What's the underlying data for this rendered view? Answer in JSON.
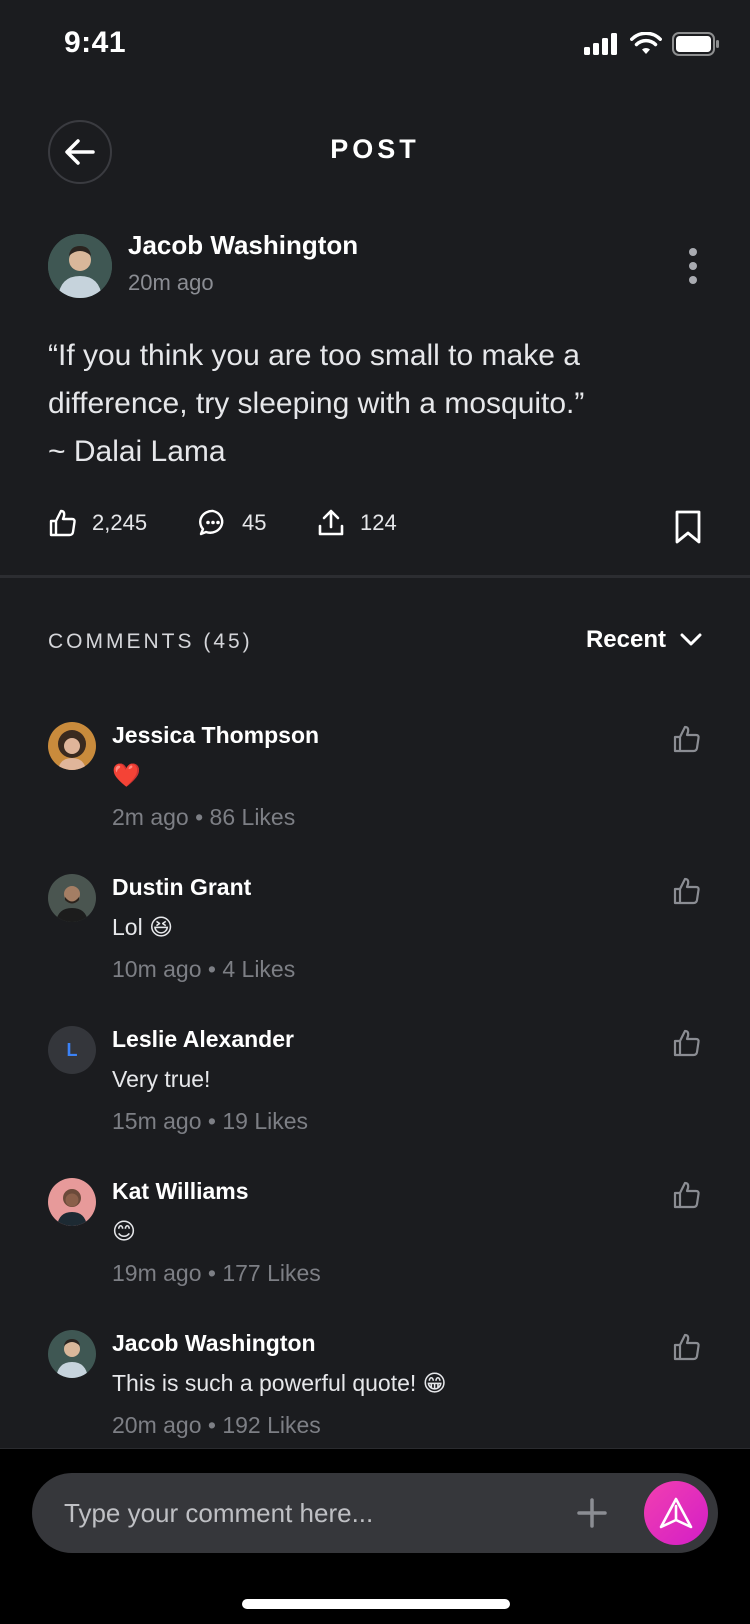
{
  "status": {
    "time": "9:41"
  },
  "header": {
    "title": "POST"
  },
  "post": {
    "author": "Jacob Washington",
    "time": "20m ago",
    "text_lines": [
      "“If you think you are too small to make a",
      "difference, try sleeping with a mosquito.”",
      "~ Dalai Lama"
    ],
    "likes": "2,245",
    "comments": "45",
    "shares": "124"
  },
  "comments_section": {
    "title": "COMMENTS (45)",
    "sort_label": "Recent",
    "items": [
      {
        "name": "Jessica Thompson",
        "text": "❤️",
        "meta": "2m ago • 86 Likes",
        "avatar_initial": "",
        "avatar_color": "#c98b3c"
      },
      {
        "name": "Dustin Grant",
        "text": "Lol 😆",
        "meta": "10m ago • 4 Likes",
        "avatar_initial": "",
        "avatar_color": "#4a5550"
      },
      {
        "name": "Leslie Alexander",
        "text": "Very true!",
        "meta": "15m ago • 19 Likes",
        "avatar_initial": "L",
        "avatar_color": "#34363b"
      },
      {
        "name": "Kat Williams",
        "text": "😊",
        "meta": "19m ago • 177 Likes",
        "avatar_initial": "",
        "avatar_color": "#e79a9a"
      },
      {
        "name": "Jacob Washington",
        "text": "This is such a powerful quote! 😁",
        "meta": "20m ago • 192 Likes",
        "avatar_initial": "",
        "avatar_color": "#3e5a55"
      }
    ]
  },
  "composer": {
    "placeholder": "Type your comment here..."
  },
  "colors": {
    "background": "#1b1c1f",
    "accent": "#e42fbd",
    "initial_color": "#3b82f6"
  }
}
